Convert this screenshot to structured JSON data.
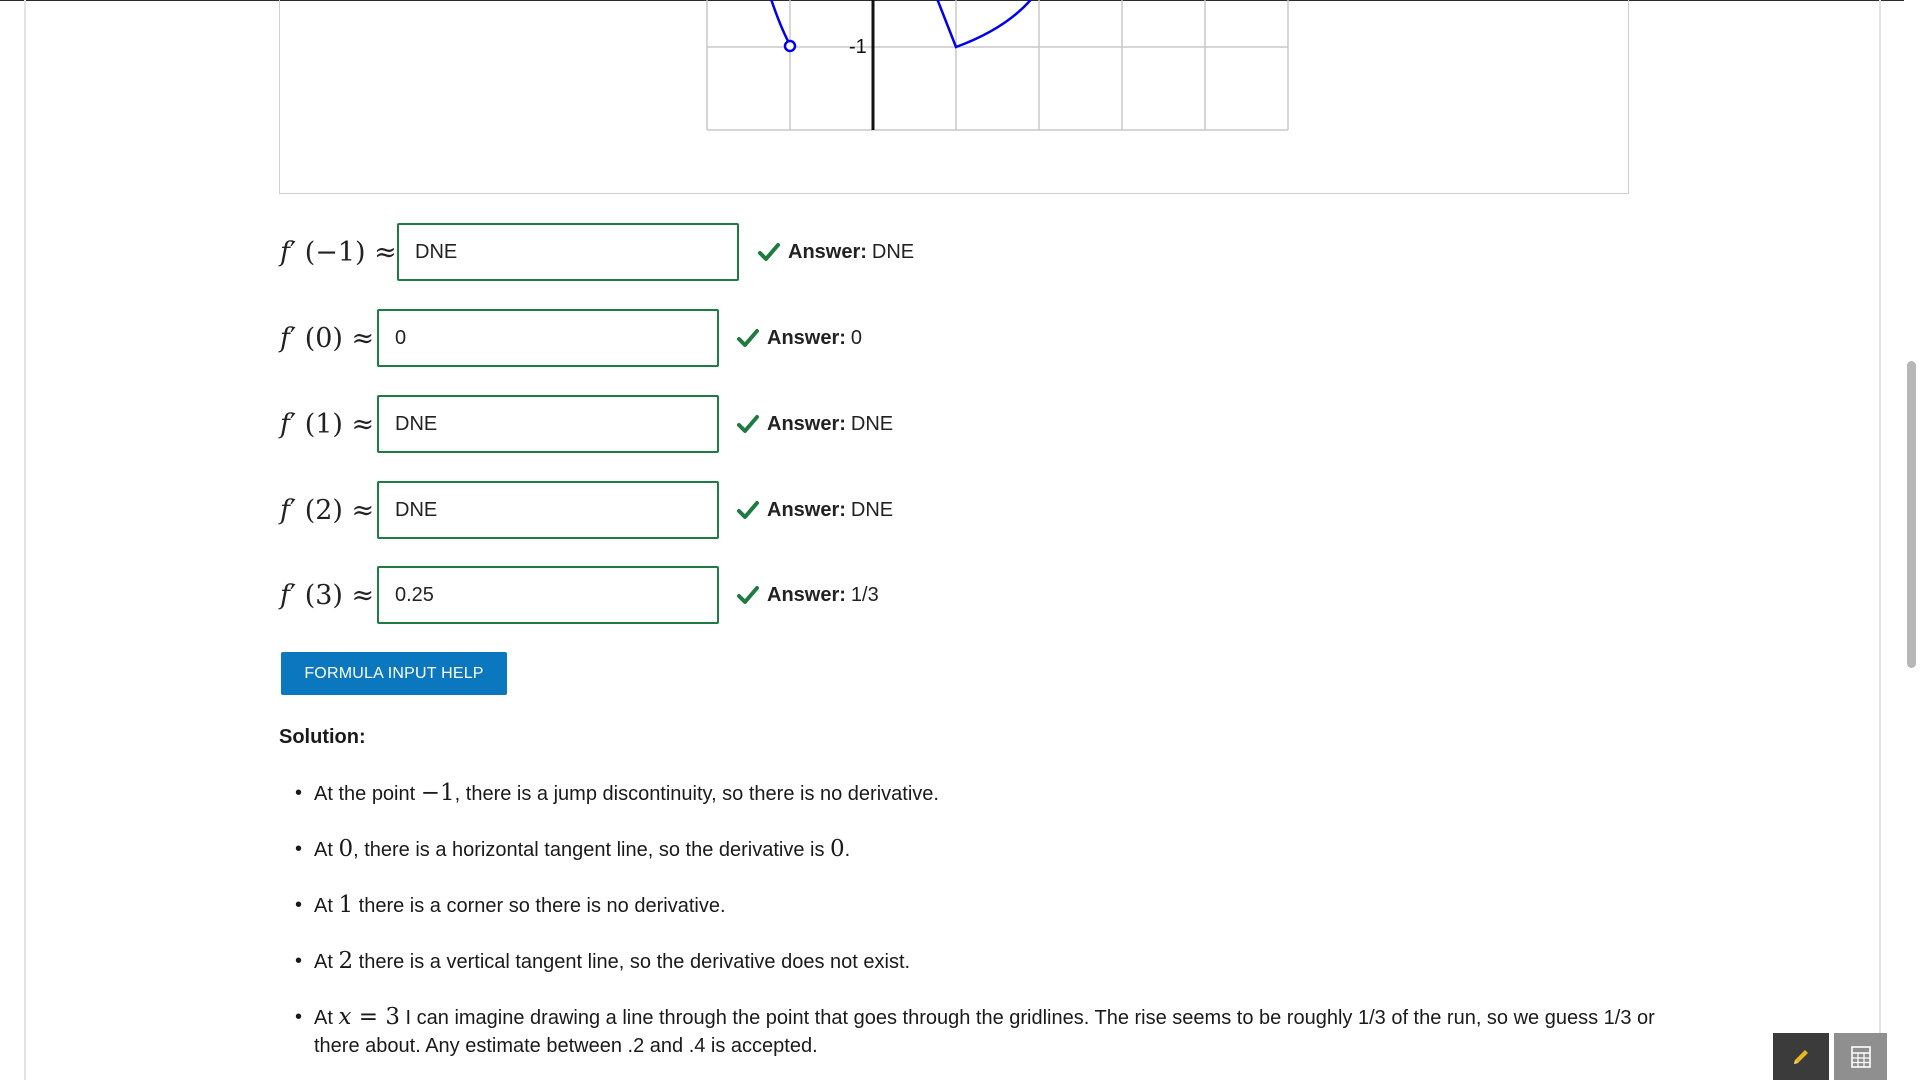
{
  "graph": {
    "tick_label": "-1",
    "curve_color": "#0000ee"
  },
  "rows": [
    {
      "label_fn": "f",
      "label_arg": "(−1) ≈",
      "value": "DNE",
      "answer_label": "Answer:",
      "answer_value": "DNE"
    },
    {
      "label_fn": "f",
      "label_arg": "(0) ≈",
      "value": "0",
      "answer_label": "Answer:",
      "answer_value": "0"
    },
    {
      "label_fn": "f",
      "label_arg": "(1) ≈",
      "value": "DNE",
      "answer_label": "Answer:",
      "answer_value": "DNE"
    },
    {
      "label_fn": "f",
      "label_arg": "(2) ≈",
      "value": "DNE",
      "answer_label": "Answer:",
      "answer_value": "DNE"
    },
    {
      "label_fn": "f",
      "label_arg": "(3) ≈",
      "value": "0.25",
      "answer_label": "Answer:",
      "answer_value": "1/3"
    }
  ],
  "help_button_label": "FORMULA INPUT HELP",
  "solution": {
    "heading": "Solution:",
    "items": [
      {
        "pre": "At the point ",
        "math": "−1",
        "post": ", there is a jump discontinuity, so there is no derivative."
      },
      {
        "pre": "At ",
        "math": "0",
        "mid": ", there is a horizontal tangent line, so the derivative is ",
        "math2": "0",
        "post": "."
      },
      {
        "pre": "At ",
        "math": "1",
        "post": " there is a corner so there is no derivative."
      },
      {
        "pre": "At ",
        "math": "2",
        "post": " there is a vertical tangent line, so the derivative does not exist."
      },
      {
        "pre": "At ",
        "math_var": "x",
        "math": " = 3",
        "post": " I can imagine drawing a line through the point that goes through the gridlines. The rise seems to be roughly 1/3 of the run, so we guess 1/3 or there about. Any estimate between .2 and .4 is accepted."
      }
    ]
  },
  "colors": {
    "accent_green": "#1e7b41",
    "button_blue": "#0a77bf"
  },
  "icons": {
    "check": "check-icon",
    "pencil": "pencil-icon",
    "calculator": "calculator-icon"
  }
}
